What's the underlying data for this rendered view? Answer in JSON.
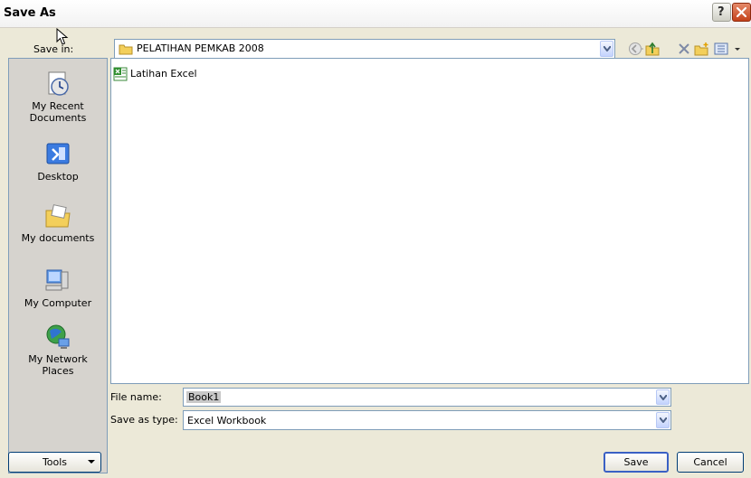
{
  "window": {
    "title": "Save As",
    "help_glyph": "?"
  },
  "toolbar": {
    "save_in_label": "Save in:",
    "save_in_value": "PELATIHAN PEMKAB 2008"
  },
  "places": [
    {
      "label": "My Recent Documents",
      "icon": "recent-documents-icon"
    },
    {
      "label": "Desktop",
      "icon": "desktop-icon"
    },
    {
      "label": "My documents",
      "icon": "my-documents-icon"
    },
    {
      "label": "My Computer",
      "icon": "my-computer-icon"
    },
    {
      "label": "My Network Places",
      "icon": "network-places-icon"
    }
  ],
  "files": [
    {
      "name": "Latihan Excel",
      "icon": "excel-workbook-icon"
    }
  ],
  "fields": {
    "file_name_label": "File name:",
    "file_name_value": "Book1",
    "save_type_label": "Save as type:",
    "save_type_value": "Excel Workbook"
  },
  "buttons": {
    "tools": "Tools",
    "save": "Save",
    "cancel": "Cancel"
  },
  "colors": {
    "accent": "#3a60c4",
    "close": "#c4421a",
    "folder": "#f3cf5b"
  }
}
